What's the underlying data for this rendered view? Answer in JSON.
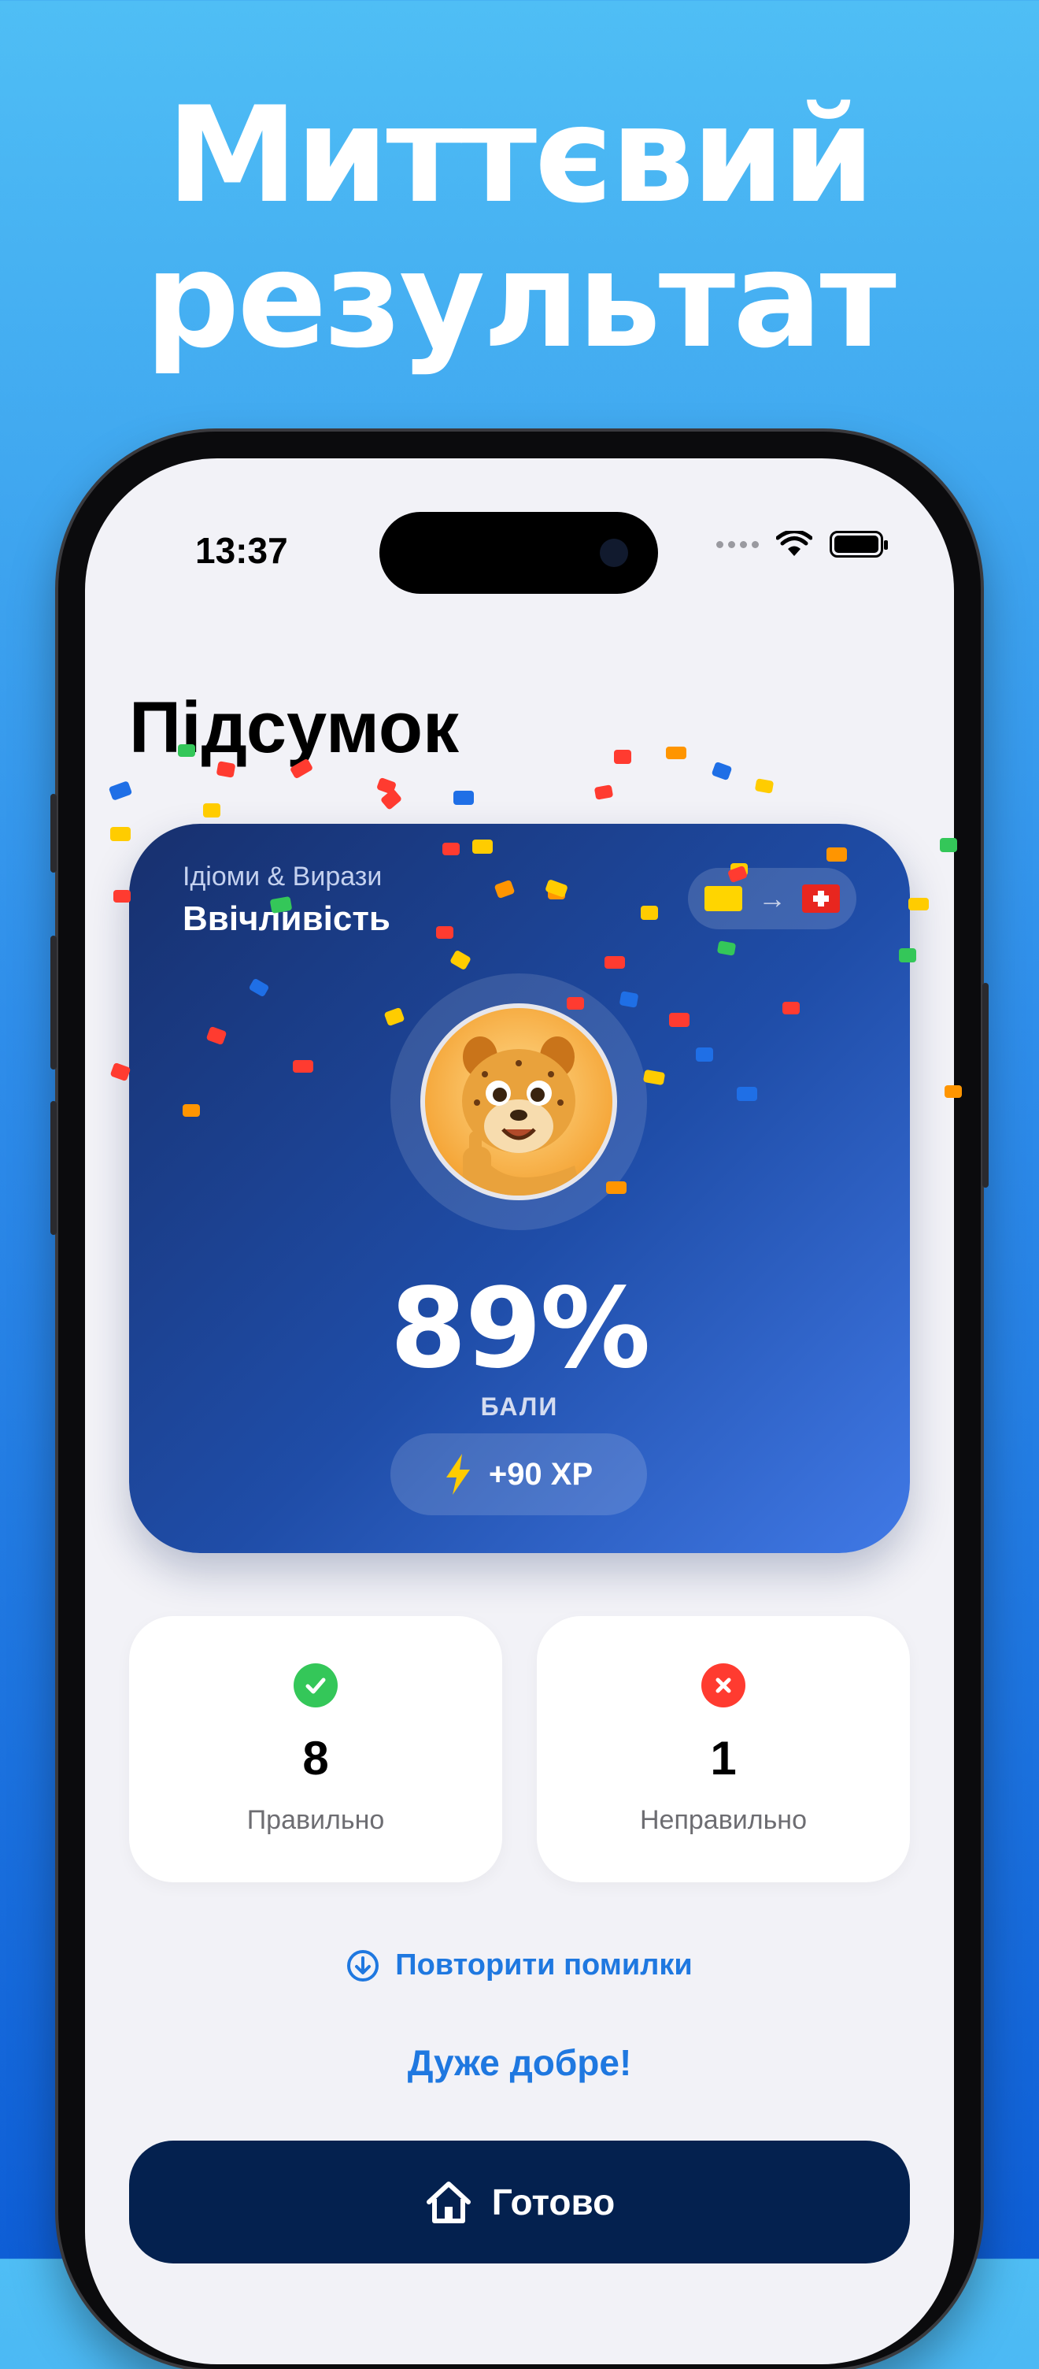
{
  "headline": {
    "line1": "Миттєвий",
    "line2": "результат"
  },
  "status_bar": {
    "time": "13:37"
  },
  "page": {
    "title": "Підсумок"
  },
  "summary_card": {
    "category": "Ідіоми & Вирази",
    "topic": "Ввічливість",
    "language_from": "flag-ukraine-icon",
    "language_to": "flag-switzerland-icon",
    "score": "89%",
    "score_label": "БАЛИ",
    "xp": "+90 XP"
  },
  "stats": {
    "correct": {
      "count": "8",
      "label": "Правильно"
    },
    "incorrect": {
      "count": "1",
      "label": "Неправильно"
    }
  },
  "actions": {
    "retry_label": "Повторити помилки",
    "praise": "Дуже добре!",
    "done_label": "Готово"
  },
  "colors": {
    "accent": "#1f78e0",
    "correct": "#34c759",
    "incorrect": "#ff3b30",
    "button": "#04214f"
  }
}
